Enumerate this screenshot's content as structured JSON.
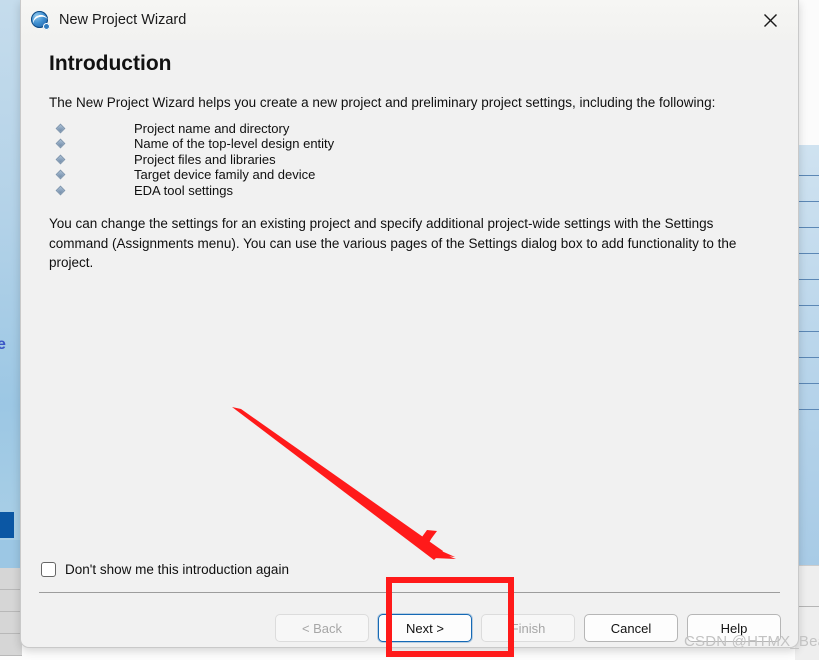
{
  "window": {
    "title": "New Project Wizard",
    "app_icon": "quartus-globe-icon",
    "close_icon": "close-icon"
  },
  "page": {
    "heading": "Introduction",
    "intro_paragraph": "The New Project Wizard helps you create a new project and preliminary project settings, including the following:",
    "bullets": [
      "Project name and directory",
      "Name of the top-level design entity",
      "Project files and libraries",
      "Target device family and device",
      "EDA tool settings"
    ],
    "closing_paragraph": "You can change the settings for an existing project and specify additional project-wide settings with the Settings command (Assignments menu). You can use the various pages of the Settings dialog box to add functionality to the project."
  },
  "options": {
    "dont_show_label": "Don't show me this introduction again",
    "dont_show_checked": false
  },
  "buttons": {
    "back": {
      "label": "< Back",
      "state": "disabled"
    },
    "next": {
      "label": "Next >",
      "state": "focused"
    },
    "finish": {
      "label": "Finish",
      "state": "disabled"
    },
    "cancel": {
      "label": "Cancel",
      "state": "enabled"
    },
    "help": {
      "label": "Help",
      "state": "enabled"
    }
  },
  "annotations": {
    "highlight_color": "#FF1A1A",
    "arrow_color": "#FF1A1A",
    "highlight_target": "Next >",
    "watermark": "CSDN @HTMX_Bean"
  },
  "background": {
    "left_letter": "e"
  },
  "colors": {
    "dialog_bg": "#F1F1F1",
    "titlebar_bg": "#F4F4F2",
    "text": "#101010",
    "accent_focus": "#1569B5",
    "annotation_red": "#FF1A1A",
    "watermark_gray": "#C3C3C3"
  }
}
